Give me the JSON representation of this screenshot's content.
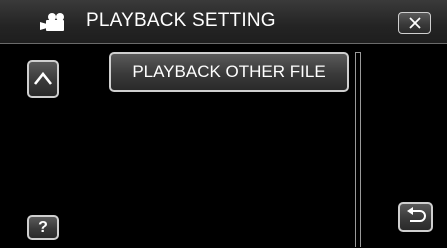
{
  "header": {
    "title": "PLAYBACK SETTING",
    "mode_icon": "video-camera-icon",
    "close_icon": "close-icon"
  },
  "menu": {
    "items": [
      {
        "label": "PLAYBACK OTHER FILE"
      }
    ]
  },
  "controls": {
    "scroll_up_icon": "chevron-up-icon",
    "help_label": "?",
    "back_icon": "return-arrow-icon"
  },
  "colors": {
    "background": "#000000",
    "button_border": "#cfcfcf",
    "text": "#ffffff"
  }
}
